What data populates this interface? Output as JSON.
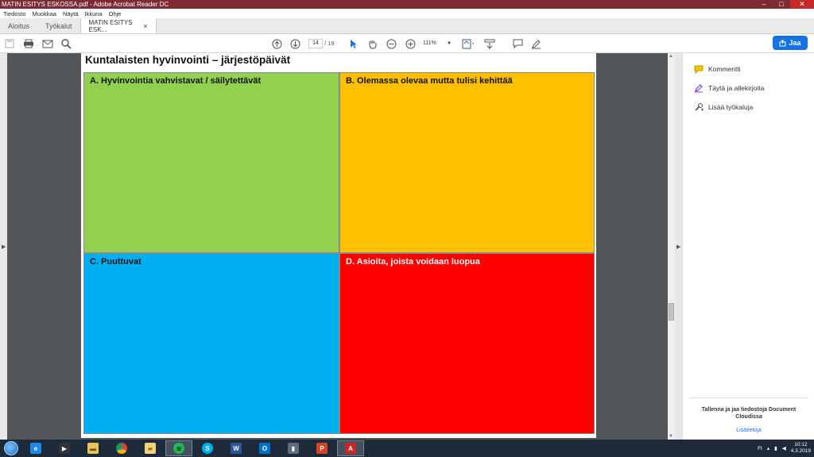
{
  "window": {
    "title": "MATIN ESITYS ESKOSSA.pdf - Adobe Acrobat Reader DC",
    "minimize": "–",
    "maximize": "□",
    "close": "✕"
  },
  "menu": [
    "Tiedosto",
    "Muokkaa",
    "Näytä",
    "Ikkuna",
    "Ohje"
  ],
  "tabs": {
    "home": "Aloitus",
    "tools": "Työkalut",
    "document": "MATIN ESITYS ESK...",
    "close": "×"
  },
  "toolbar": {
    "page_current": "14",
    "page_total": "/ 19",
    "zoom": "111%",
    "share_label": "Jaa"
  },
  "document": {
    "title": "Kuntalaisten hyvinvointi – järjestöpäivät",
    "quadrants": {
      "a": "A. Hyvinvointia vahvistavat / säilytettävät",
      "b": "B. Olemassa olevaa mutta tulisi kehittää",
      "c": "C. Puuttuvat",
      "d": "D. Asioita, joista voidaan luopua"
    },
    "colors": {
      "a": "#92d050",
      "b": "#ffc000",
      "c": "#00b0f0",
      "d": "#ff0000"
    }
  },
  "right_panel": {
    "items": [
      {
        "label": "Kommentti",
        "icon": "comment-icon"
      },
      {
        "label": "Täytä ja allekirjoita",
        "icon": "fill-sign-icon"
      },
      {
        "label": "Lisää työkaluja",
        "icon": "more-tools-icon"
      }
    ],
    "footer_text": "Tallenna ja jaa tiedostoja Document Cloudissa",
    "footer_link": "Lisätietoja"
  },
  "taskbar": {
    "apps": [
      {
        "name": "ie",
        "glyph": "e"
      },
      {
        "name": "media",
        "glyph": "▶"
      },
      {
        "name": "explorer",
        "glyph": "▬"
      },
      {
        "name": "chrome",
        "glyph": "●"
      },
      {
        "name": "folder",
        "glyph": "▰"
      },
      {
        "name": "spotify",
        "glyph": "≋"
      },
      {
        "name": "skype",
        "glyph": "S"
      },
      {
        "name": "word",
        "glyph": "W"
      },
      {
        "name": "outlook",
        "glyph": "O"
      },
      {
        "name": "app",
        "glyph": "▮"
      },
      {
        "name": "powerpoint",
        "glyph": "P"
      },
      {
        "name": "acrobat",
        "glyph": "A"
      }
    ],
    "language": "FI",
    "time": "10:12",
    "date": "4.3.2019"
  },
  "accent_color": "#1473e6"
}
